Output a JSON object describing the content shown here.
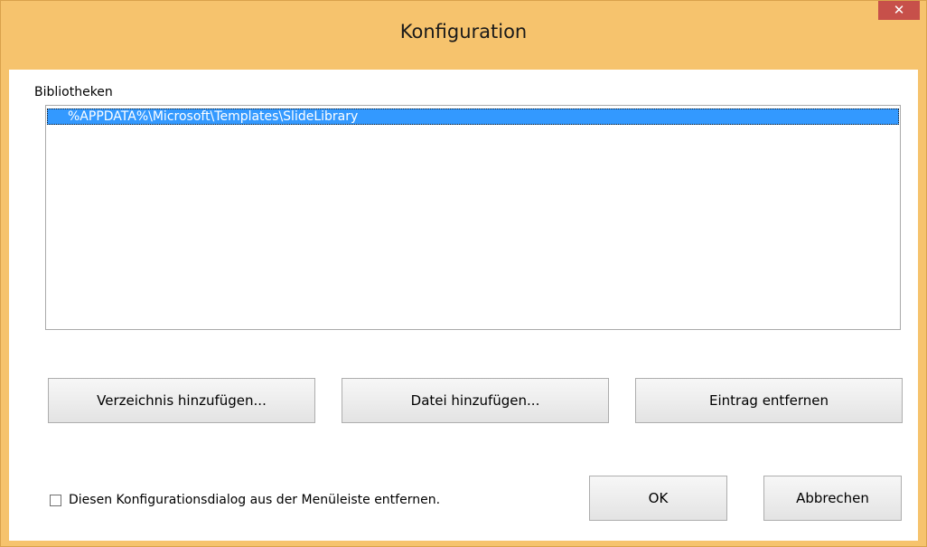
{
  "window": {
    "title": "Konfiguration",
    "close_label": "✕"
  },
  "libraries": {
    "label": "Bibliotheken",
    "items": [
      {
        "path": "%APPDATA%\\Microsoft\\Templates\\SlideLibrary",
        "selected": true
      }
    ]
  },
  "actions": {
    "add_directory": "Verzeichnis hinzufügen...",
    "add_file": "Datei hinzufügen...",
    "remove_entry": "Eintrag entfernen"
  },
  "options": {
    "remove_from_menu_label": "Diesen Konfigurationsdialog aus der Menüleiste entfernen.",
    "remove_from_menu_checked": false
  },
  "footer": {
    "ok": "OK",
    "cancel": "Abbrechen"
  },
  "colors": {
    "titlebar": "#f6c36d",
    "close_button": "#c7504a",
    "selection": "#3399ff"
  }
}
